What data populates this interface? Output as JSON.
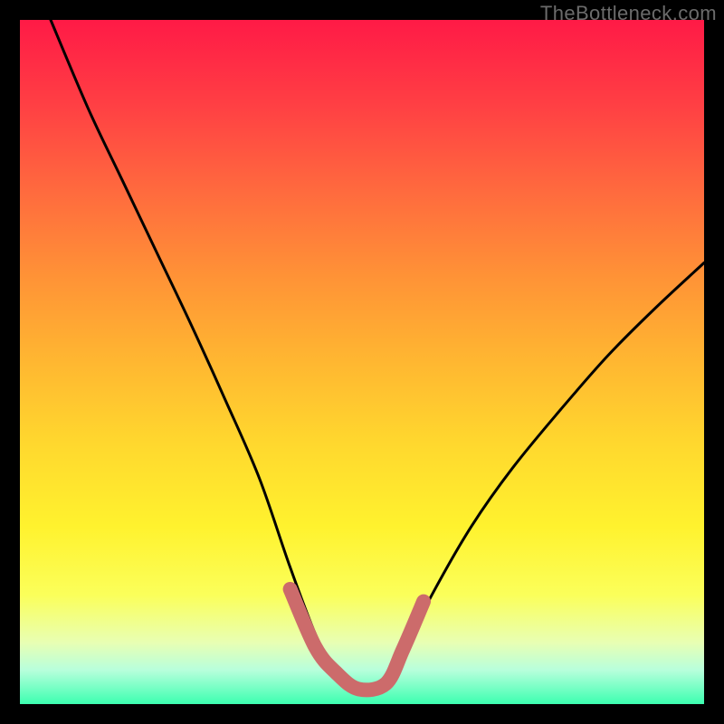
{
  "watermark": "TheBottleneck.com",
  "chart_data": {
    "type": "line",
    "title": "",
    "xlabel": "",
    "ylabel": "",
    "xlim": [
      0,
      1
    ],
    "ylim": [
      0,
      1
    ],
    "series": [
      {
        "name": "left-curve",
        "x": [
          0.045,
          0.1,
          0.15,
          0.2,
          0.25,
          0.3,
          0.35,
          0.395,
          0.435,
          0.465
        ],
        "y": [
          1.0,
          0.87,
          0.765,
          0.66,
          0.555,
          0.445,
          0.33,
          0.2,
          0.095,
          0.045
        ]
      },
      {
        "name": "right-curve",
        "x": [
          0.54,
          0.57,
          0.605,
          0.66,
          0.72,
          0.79,
          0.86,
          0.93,
          1.0
        ],
        "y": [
          0.04,
          0.095,
          0.165,
          0.26,
          0.345,
          0.43,
          0.51,
          0.58,
          0.645
        ]
      },
      {
        "name": "valley-highlight",
        "x": [
          0.395,
          0.432,
          0.462,
          0.495,
          0.535,
          0.56,
          0.59
        ],
        "y": [
          0.168,
          0.083,
          0.046,
          0.022,
          0.03,
          0.08,
          0.15
        ]
      }
    ],
    "highlight_color": "#cc6b6b",
    "curve_color": "#000000"
  }
}
